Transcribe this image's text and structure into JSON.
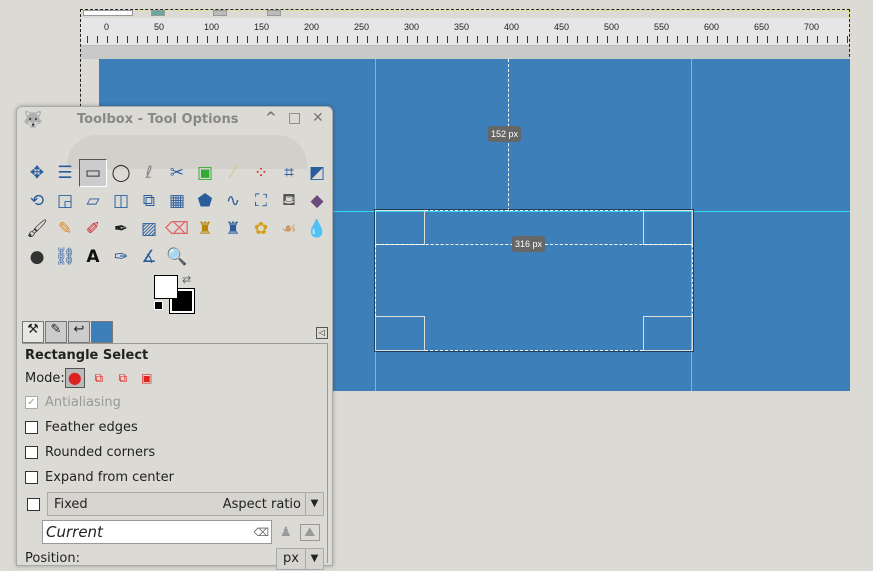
{
  "ruler": {
    "labels": [
      "0",
      "50",
      "100",
      "150",
      "200",
      "250",
      "300",
      "350",
      "400",
      "450",
      "500",
      "550",
      "600",
      "650",
      "700"
    ]
  },
  "canvas": {
    "color": "#3d7fb8",
    "guide_color": "#35d6f0",
    "dim_vertical": "152 px",
    "dim_horizontal": "316 px"
  },
  "toolbox": {
    "title": "Toolbox - Tool Options",
    "buttons": {
      "minimize": "^",
      "maximize": "□",
      "close": "✕"
    },
    "tools": [
      {
        "name": "move",
        "g": "✥",
        "c": "#2a5d9c"
      },
      {
        "name": "align",
        "g": "☰",
        "c": "#2a5d9c"
      },
      {
        "name": "rect-select",
        "g": "▭",
        "c": "#333",
        "active": true
      },
      {
        "name": "ellipse-select",
        "g": "◯",
        "c": "#333"
      },
      {
        "name": "free-select",
        "g": "ℓ",
        "c": "#888"
      },
      {
        "name": "scissors",
        "g": "✂",
        "c": "#2a5d9c"
      },
      {
        "name": "foreground-select",
        "g": "▣",
        "c": "#3a3"
      },
      {
        "name": "fuzzy-select",
        "g": "⁄",
        "c": "#cc8"
      },
      {
        "name": "color-select",
        "g": "⁘",
        "c": "#c22"
      },
      {
        "name": "crop",
        "g": "⌗",
        "c": "#2a5d9c"
      },
      {
        "name": "unified-transform",
        "g": "◩",
        "c": "#2a5d9c"
      },
      {
        "name": "rotate",
        "g": "⟲",
        "c": "#2a5d9c"
      },
      {
        "name": "scale",
        "g": "◲",
        "c": "#2a5d9c"
      },
      {
        "name": "shear",
        "g": "▱",
        "c": "#2a5d9c"
      },
      {
        "name": "flip",
        "g": "◫",
        "c": "#2a5d9c"
      },
      {
        "name": "3d-transform",
        "g": "⧉",
        "c": "#2a5d9c"
      },
      {
        "name": "perspective",
        "g": "▦",
        "c": "#2a5d9c"
      },
      {
        "name": "cage",
        "g": "⬟",
        "c": "#2a5d9c"
      },
      {
        "name": "warp",
        "g": "∿",
        "c": "#2a5d9c"
      },
      {
        "name": "handle-transform",
        "g": "⛶",
        "c": "#2a5d9c"
      },
      {
        "name": "bucket-fill",
        "g": "⛾",
        "c": "#555"
      },
      {
        "name": "blend",
        "g": "◆",
        "c": "#6a4a7a"
      },
      {
        "name": "paintbrush",
        "g": "🖌",
        "c": "#333"
      },
      {
        "name": "pencil",
        "g": "✎",
        "c": "#e08a20"
      },
      {
        "name": "airbrush",
        "g": "✐",
        "c": "#c22"
      },
      {
        "name": "ink",
        "g": "✒",
        "c": "#222"
      },
      {
        "name": "mypaint",
        "g": "▨",
        "c": "#2a5d9c"
      },
      {
        "name": "eraser",
        "g": "⌫",
        "c": "#d66"
      },
      {
        "name": "clone",
        "g": "♜",
        "c": "#b8860b"
      },
      {
        "name": "heal",
        "g": "♜",
        "c": "#2a5d9c"
      },
      {
        "name": "perspective-clone",
        "g": "✿",
        "c": "#d4a017"
      },
      {
        "name": "smudge",
        "g": "☙",
        "c": "#c96"
      },
      {
        "name": "blur",
        "g": "💧",
        "c": "#2a6db0"
      },
      {
        "name": "dodge-burn",
        "g": "●",
        "c": "#333"
      },
      {
        "name": "paths",
        "g": "⛓",
        "c": "#2a5d9c"
      },
      {
        "name": "text",
        "g": "A",
        "c": "#111"
      },
      {
        "name": "color-picker",
        "g": "✑",
        "c": "#2a5d9c"
      },
      {
        "name": "measure",
        "g": "∡",
        "c": "#2a5d9c"
      },
      {
        "name": "zoom",
        "g": "🔍",
        "c": "#2a5d9c"
      }
    ],
    "options": {
      "title": "Rectangle Select",
      "mode_label": "Mode:",
      "antialiasing": {
        "label": "Antialiasing",
        "checked": true,
        "disabled": true
      },
      "feather": {
        "label": "Feather edges",
        "checked": false
      },
      "rounded": {
        "label": "Rounded corners",
        "checked": false
      },
      "expand": {
        "label": "Expand from center",
        "checked": false
      },
      "fixed": {
        "label": "Fixed",
        "value": "Aspect ratio",
        "checked": false
      },
      "current": "Current",
      "position_label": "Position:",
      "unit": "px"
    }
  }
}
